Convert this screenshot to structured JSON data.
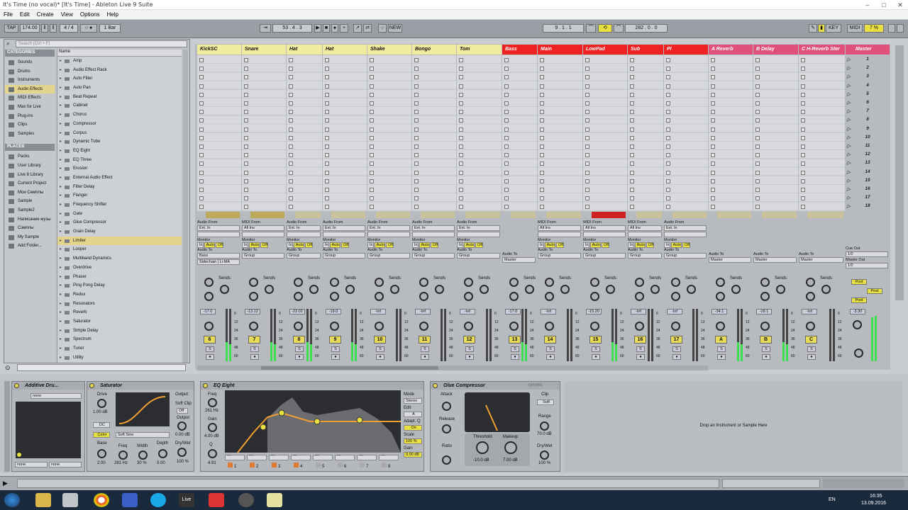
{
  "window": {
    "title": "It's Time (no vocal)* [It's Time] - Ableton Live 9 Suite"
  },
  "menu": [
    "File",
    "Edit",
    "Create",
    "View",
    "Options",
    "Help"
  ],
  "transport": {
    "tap": "TAP",
    "tempo": "174.00",
    "sig": "4 / 4",
    "metro": "○ ●",
    "quant": "1 Bar",
    "position": "53 . 4 . 3",
    "new_label": "NEW",
    "loop_start": "9 . 1 . 1",
    "loop_len": "282 . 0 . 0",
    "key": "KEY",
    "midi": "MIDI",
    "cpu": "7 %"
  },
  "browser": {
    "search_placeholder": "Search (Ctrl + F)",
    "categories_header": "CATEGORIES",
    "categories": [
      "Sounds",
      "Drums",
      "Instruments",
      "Audio Effects",
      "MIDI Effects",
      "Max for Live",
      "Plug-ins",
      "Clips",
      "Samples"
    ],
    "selected_category": "Audio Effects",
    "places_header": "PLACES",
    "places": [
      "Packs",
      "User Library",
      "Live 8 Library",
      "Current Project",
      "Мои Семплы",
      "Sample",
      "Sample2",
      "Написание музы",
      "Сэмплы",
      "My Sample",
      "Add Folder..."
    ],
    "name_header": "Name",
    "items": [
      "Amp",
      "Audio Effect Rack",
      "Auto Filter",
      "Auto Pan",
      "Beat Repeat",
      "Cabinet",
      "Chorus",
      "Compressor",
      "Corpus",
      "Dynamic Tube",
      "EQ Eight",
      "EQ Three",
      "Erosion",
      "External Audio Effect",
      "Filter Delay",
      "Flanger",
      "Frequency Shifter",
      "Gate",
      "Glue Compressor",
      "Grain Delay",
      "Limiter",
      "Looper",
      "Multiband Dynamics",
      "Overdrive",
      "Phaser",
      "Ping Pong Delay",
      "Redux",
      "Resonators",
      "Reverb",
      "Saturator",
      "Simple Delay",
      "Spectrum",
      "Tuner",
      "Utility"
    ],
    "selected_item": "Limiter"
  },
  "tracks": [
    {
      "name": "KickSC",
      "num": "6",
      "vol": "-17.0",
      "color": "#f2eca0",
      "route_to": "Bass",
      "input_type": "Audio From",
      "input": "Ext. In"
    },
    {
      "name": "Snare",
      "num": "7",
      "vol": "-13.12",
      "color": "#f2eca0",
      "route_to": "Group",
      "input_type": "MIDI From",
      "input": "All Ins"
    },
    {
      "name": "Hat",
      "num": "8",
      "vol": "-22.02",
      "color": "#f2eca0",
      "route_to": "Group",
      "input_type": "Audio From",
      "input": "Ext. In"
    },
    {
      "name": "Hat",
      "num": "9",
      "vol": "-19.0",
      "color": "#f2eca0",
      "route_to": "Group",
      "input_type": "Audio From",
      "input": "Ext. In"
    },
    {
      "name": "Shake",
      "num": "10",
      "vol": "-Inf",
      "color": "#f2eca0",
      "route_to": "Group",
      "input_type": "Audio From",
      "input": "Ext. In"
    },
    {
      "name": "Bongo",
      "num": "11",
      "vol": "-Inf",
      "color": "#f2eca0",
      "route_to": "Group",
      "input_type": "Audio From",
      "input": "Ext. In"
    },
    {
      "name": "Tom",
      "num": "12",
      "vol": "-Inf",
      "color": "#f2eca0",
      "route_to": "Group",
      "input_type": "Audio From",
      "input": "Ext. In"
    },
    {
      "name": "Bass",
      "num": "13",
      "vol": "-17.0",
      "color": "#ee2222",
      "route_to": "Master",
      "input_type": "",
      "input": ""
    },
    {
      "name": "Main",
      "num": "14",
      "vol": "-Inf",
      "color": "#ee2222",
      "route_to": "Group",
      "input_type": "MIDI From",
      "input": "All Ins"
    },
    {
      "name": "LowPad",
      "num": "15",
      "vol": "-15.20",
      "color": "#ee2222",
      "route_to": "Group",
      "input_type": "MIDI From",
      "input": "All Ins"
    },
    {
      "name": "Sub",
      "num": "16",
      "vol": "-Inf",
      "color": "#ee2222",
      "route_to": "Group",
      "input_type": "MIDI From",
      "input": "All Ins"
    },
    {
      "name": "Pl",
      "num": "17",
      "vol": "-Inf",
      "color": "#ee2222",
      "route_to": "Group",
      "input_type": "Audio From",
      "input": "Ext. In"
    },
    {
      "name": "A Reverb",
      "num": "A",
      "vol": "-34.1",
      "color": "#e0507a",
      "route_to": "Master",
      "input_type": "",
      "input": ""
    },
    {
      "name": "B Delay",
      "num": "B",
      "vol": "-18.1",
      "color": "#e0507a",
      "route_to": "Master",
      "input_type": "",
      "input": ""
    },
    {
      "name": "C H-Reverb Ster",
      "num": "C",
      "vol": "-Inf",
      "color": "#e0507a",
      "route_to": "Master",
      "input_type": "",
      "input": ""
    },
    {
      "name": "Master",
      "num": "",
      "vol": "-3.30",
      "color": "#e0507a",
      "route_to": "",
      "input_type": "",
      "input": ""
    }
  ],
  "scenes": [
    "1",
    "2",
    "3",
    "4",
    "5",
    "6",
    "7",
    "8",
    "9",
    "10",
    "11",
    "12",
    "13",
    "14",
    "15",
    "16",
    "17",
    "18"
  ],
  "labels": {
    "monitor": "Monitor",
    "in": "In",
    "auto": "Auto",
    "off": "Off",
    "audio_to": "Audio To",
    "sends": "Sends",
    "cue_out": "Cue Out",
    "master_out": "Master Out",
    "cue_val": "1/2",
    "master_val": "1/2",
    "post": "Post",
    "sidechain": "Sidechain | Li-MA"
  },
  "devices": {
    "additive": {
      "title": "Additive Dru...",
      "preset": "none",
      "none1": "none",
      "none2": "none"
    },
    "saturator": {
      "title": "Saturator",
      "drive": "Drive",
      "drive_val": "1.00 dB",
      "dc": "DC",
      "color": "Color",
      "base": "Base",
      "freq": "Freq",
      "width": "Width",
      "depth": "Depth",
      "base_val": "2.00",
      "freq_val": "281 Hz",
      "width_val": "30 %",
      "depth_val": "0.00",
      "soft": "Soft Sine",
      "output": "Output",
      "soft_clip": "Soft Clip",
      "soft_clip_val": "Off",
      "output_val": "0.00 dB",
      "drywet": "Dry/Wet",
      "drywet_val": "100 %"
    },
    "eq": {
      "title": "EQ Eight",
      "freq": "Freq",
      "freq_val": "261 Hz",
      "gain": "Gain",
      "gain_val": "4.00 dB",
      "q": "Q",
      "q_val": "4.91",
      "mode": "Mode",
      "mode_val": "Stereo",
      "edit": "Edit",
      "edit_val": "A",
      "adapt": "Adapt. Q",
      "adapt_val": "On",
      "scale": "Scale",
      "scale_val": "100 %",
      "gain2": "Gain",
      "gain2_val": "0.00 dB",
      "bands": [
        "1",
        "2",
        "3",
        "4",
        "5",
        "6",
        "7",
        "8"
      ]
    },
    "glue": {
      "title": "Glue Compressor",
      "attack": "Attack",
      "release": "Release",
      "ratio": "Ratio",
      "threshold": "Threshold",
      "threshold_val": "-10.0 dB",
      "makeup": "Makeup",
      "makeup_val": "7.00 dB",
      "clip": "Clip",
      "soft": "Soft",
      "range": "Range",
      "range_val": "70.0 dB",
      "drywet": "Dry/Wet",
      "drywet_val": "100 %",
      "brand": "cytomic"
    },
    "drop_hint": "Drop an Instrument or Sample Here"
  },
  "taskbar": {
    "lang": "EN",
    "time": "16:35",
    "date": "13.09.2016"
  }
}
